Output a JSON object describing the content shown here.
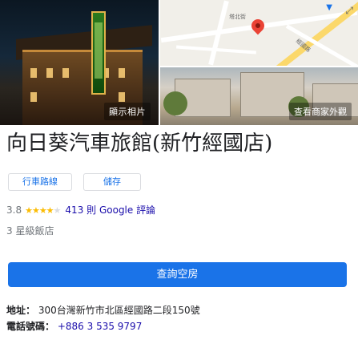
{
  "photos": {
    "left_label": "顯示相片",
    "right_label": "查看商家外觀",
    "map": {
      "street_label_1": "塔北街",
      "street_label_2": "經國路"
    }
  },
  "title": "向日葵汽車旅館(新竹經國店)",
  "actions": {
    "route": "行車路線",
    "save": "儲存"
  },
  "rating": {
    "score": "3.8",
    "stars_full": "★★★★",
    "stars_empty": "★",
    "reviews": "413 則 Google 評論"
  },
  "hotel_class": "3 星級飯店",
  "book_button": "查詢空房",
  "address": {
    "label": "地址：",
    "value": "300台灣新竹市北區經國路二段150號"
  },
  "phone": {
    "label": "電話號碼：",
    "value": "+886 3 535 9797"
  },
  "colors": {
    "accent": "#1a73e8",
    "star": "#fbbc04",
    "link": "#1a0dab"
  }
}
